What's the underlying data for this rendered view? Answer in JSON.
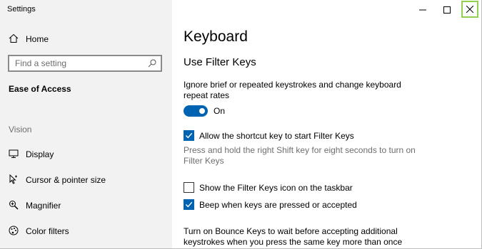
{
  "app": {
    "title": "Settings"
  },
  "sidebar": {
    "home_label": "Home",
    "search": {
      "placeholder": "Find a setting"
    },
    "category": "Ease of Access",
    "section_label": "Vision",
    "items": [
      {
        "label": "Display",
        "icon": "monitor-icon"
      },
      {
        "label": "Cursor & pointer size",
        "icon": "cursor-icon"
      },
      {
        "label": "Magnifier",
        "icon": "magnifier-icon"
      },
      {
        "label": "Color filters",
        "icon": "color-filters-icon"
      }
    ]
  },
  "window_controls": {
    "minimize": "minimize-icon",
    "maximize": "maximize-icon",
    "close": "close-icon"
  },
  "main": {
    "title": "Keyboard",
    "subtitle": "Use Filter Keys",
    "description": "Ignore brief or repeated keystrokes and change keyboard repeat rates",
    "toggle": {
      "state_label": "On",
      "on": true
    },
    "checkboxes": [
      {
        "label": "Allow the shortcut key to start Filter Keys",
        "checked": true
      },
      {
        "label": "Show the Filter Keys icon on the taskbar",
        "checked": false
      },
      {
        "label": "Beep when keys are pressed or accepted",
        "checked": true
      }
    ],
    "shortcut_hint": "Press and hold the right Shift key for eight seconds to turn on Filter Keys",
    "bounce_text": "Turn on Bounce Keys to wait before accepting additional keystrokes when you press the same key more than once"
  },
  "colors": {
    "accent": "#0063b1",
    "sidebar_bg": "#f2f2f2",
    "close_highlight": "#92d050"
  }
}
